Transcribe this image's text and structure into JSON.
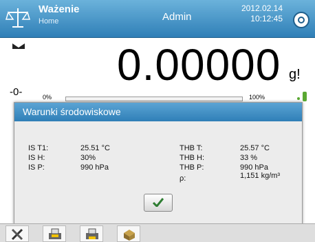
{
  "header": {
    "title": "Ważenie",
    "subtitle": "Home",
    "user": "Admin",
    "date": "2012.02.14",
    "time": "10:12:45"
  },
  "display": {
    "weight": "0.00000",
    "unit": "g!",
    "zero_indicator": "-0-",
    "range_min": "0%",
    "range_max": "100%",
    "range_fill_fraction": 0.0
  },
  "dialog": {
    "title": "Warunki środowiskowe",
    "left": [
      {
        "label": "IS T1:",
        "value": "25.51 °C"
      },
      {
        "label": "IS H:",
        "value": "30%"
      },
      {
        "label": "IS P:",
        "value": "990 hPa"
      }
    ],
    "right": [
      {
        "label": "THB T:",
        "value": "25.57 °C"
      },
      {
        "label": "THB H:",
        "value": "33 %"
      },
      {
        "label": "THB P:",
        "value": "990 hPa"
      },
      {
        "label": "ρ:",
        "value": "1,151 kg/m³"
      }
    ],
    "ok_icon": "checkmark-icon"
  },
  "toolbar": {
    "icons": [
      "tools-icon",
      "printer-header-icon",
      "printer-footer-icon",
      "database-icon"
    ]
  },
  "colors": {
    "header": "#2f7fb7",
    "accent_green": "#2e7d32"
  }
}
